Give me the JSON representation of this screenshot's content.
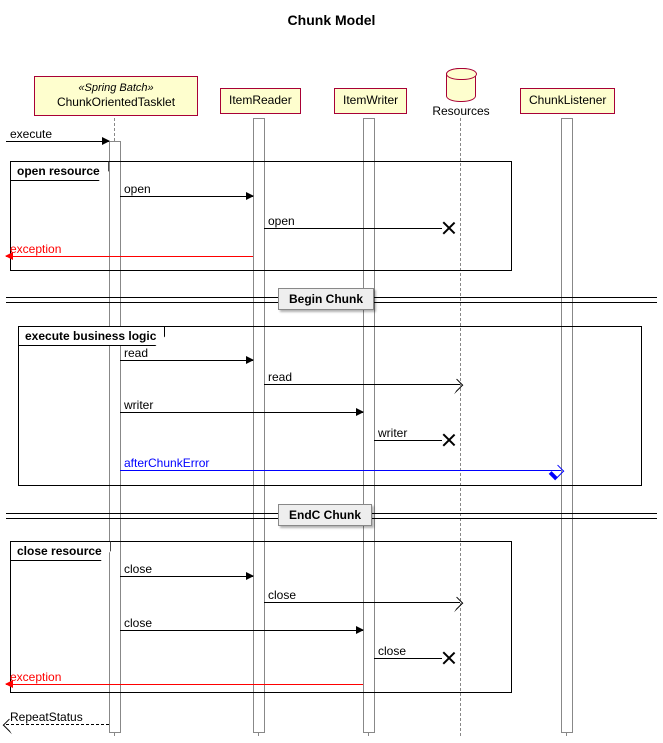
{
  "title": "Chunk Model",
  "participants": {
    "tasklet": {
      "stereotype": "«Spring Batch»",
      "name": "ChunkOrientedTasklet"
    },
    "reader": "ItemReader",
    "writer": "ItemWriter",
    "resources": "Resources",
    "listener": "ChunkListener"
  },
  "groups": {
    "open": "open resource",
    "exec": "execute business logic",
    "close": "close resource"
  },
  "dividers": {
    "begin": "Begin Chunk",
    "end": "EndC Chunk"
  },
  "messages": {
    "execute": "execute",
    "open1": "open",
    "open2": "open",
    "exception1": "exception",
    "read1": "read",
    "read2": "read",
    "writer1": "writer",
    "writer2": "writer",
    "afterChunkError": "afterChunkError",
    "close1": "close",
    "close2": "close",
    "close3": "close",
    "close4": "close",
    "exception2": "exception",
    "repeatStatus": "RepeatStatus"
  },
  "chart_data": {
    "type": "sequence-diagram",
    "title": "Chunk Model",
    "participants": [
      {
        "id": "caller",
        "name": "",
        "type": "actor"
      },
      {
        "id": "tasklet",
        "name": "ChunkOrientedTasklet",
        "stereotype": "Spring Batch",
        "type": "participant"
      },
      {
        "id": "reader",
        "name": "ItemReader",
        "type": "participant"
      },
      {
        "id": "writer",
        "name": "ItemWriter",
        "type": "participant"
      },
      {
        "id": "resources",
        "name": "Resources",
        "type": "database"
      },
      {
        "id": "listener",
        "name": "ChunkListener",
        "type": "participant"
      }
    ],
    "interactions": [
      {
        "from": "caller",
        "to": "tasklet",
        "label": "execute",
        "type": "sync"
      },
      {
        "group": "open resource",
        "messages": [
          {
            "from": "tasklet",
            "to": "reader",
            "label": "open",
            "type": "sync"
          },
          {
            "from": "reader",
            "to": "resources",
            "label": "open",
            "type": "sync",
            "destroy": true
          },
          {
            "from": "reader",
            "to": "caller",
            "label": "exception",
            "type": "sync",
            "color": "red"
          }
        ]
      },
      {
        "divider": "Begin Chunk"
      },
      {
        "group": "execute business logic",
        "messages": [
          {
            "from": "tasklet",
            "to": "reader",
            "label": "read",
            "type": "sync"
          },
          {
            "from": "reader",
            "to": "resources",
            "label": "read",
            "type": "sync"
          },
          {
            "from": "tasklet",
            "to": "writer",
            "label": "writer",
            "type": "sync"
          },
          {
            "from": "writer",
            "to": "resources",
            "label": "writer",
            "type": "sync",
            "destroy": true
          },
          {
            "from": "tasklet",
            "to": "listener",
            "label": "afterChunkError",
            "type": "sync",
            "color": "blue"
          }
        ]
      },
      {
        "divider": "EndC Chunk"
      },
      {
        "group": "close resource",
        "messages": [
          {
            "from": "tasklet",
            "to": "reader",
            "label": "close",
            "type": "sync"
          },
          {
            "from": "reader",
            "to": "resources",
            "label": "close",
            "type": "sync"
          },
          {
            "from": "tasklet",
            "to": "writer",
            "label": "close",
            "type": "sync"
          },
          {
            "from": "writer",
            "to": "resources",
            "label": "close",
            "type": "sync",
            "destroy": true
          },
          {
            "from": "writer",
            "to": "caller",
            "label": "exception",
            "type": "sync",
            "color": "red"
          }
        ]
      },
      {
        "from": "tasklet",
        "to": "caller",
        "label": "RepeatStatus",
        "type": "return"
      }
    ]
  }
}
